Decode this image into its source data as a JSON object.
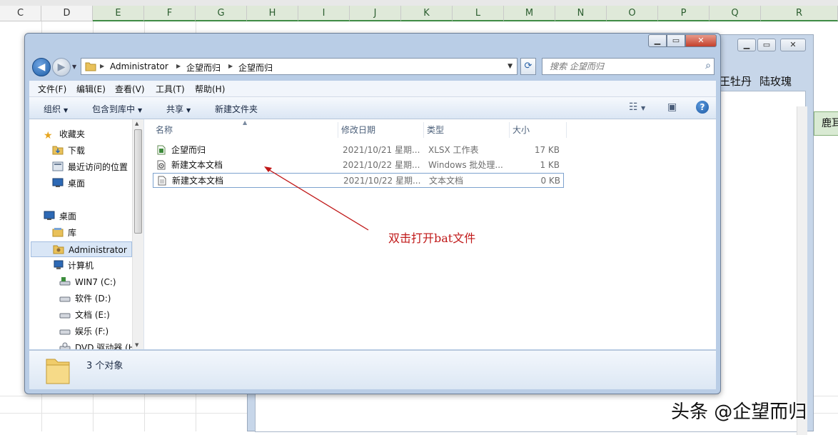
{
  "sheet": {
    "columns": [
      "C",
      "D",
      "E",
      "F",
      "G",
      "H",
      "I",
      "J",
      "K",
      "L",
      "M",
      "N",
      "O",
      "P",
      "Q",
      "R"
    ],
    "selected_columns": [
      "E",
      "F",
      "G",
      "H",
      "I",
      "J",
      "K",
      "L",
      "M",
      "N",
      "O",
      "P",
      "Q",
      "R"
    ]
  },
  "background_window": {
    "visible_text_1": "王牡丹",
    "visible_text_2": "陆玫瑰",
    "green_cell_text": "鹿耳"
  },
  "explorer": {
    "address": {
      "segments": [
        "Administrator",
        "企望而归",
        "企望而归"
      ]
    },
    "search": {
      "placeholder": "搜索 企望而归"
    },
    "menu": [
      "文件(F)",
      "编辑(E)",
      "查看(V)",
      "工具(T)",
      "帮助(H)"
    ],
    "toolbar": {
      "organize": "组织",
      "include_in_library": "包含到库中",
      "share": "共享",
      "new_folder": "新建文件夹",
      "help_icon": "?"
    },
    "nav_pane": {
      "favorites": "收藏夹",
      "downloads": "下载",
      "recent": "最近访问的位置",
      "desktop_fav": "桌面",
      "desktop": "桌面",
      "libraries": "库",
      "administrator": "Administrator",
      "computer": "计算机",
      "drive_c": "WIN7 (C:)",
      "drive_d": "软件 (D:)",
      "drive_e": "文档 (E:)",
      "drive_f": "娱乐 (F:)",
      "drive_dvd": "DVD 驱动器 (H"
    },
    "columns": {
      "name": "名称",
      "modified": "修改日期",
      "type": "类型",
      "size": "大小"
    },
    "files": [
      {
        "name": "企望而归",
        "modified": "2021/10/21 星期...",
        "type": "XLSX 工作表",
        "size": "17 KB",
        "icon": "xlsx-icon"
      },
      {
        "name": "新建文本文档",
        "modified": "2021/10/22 星期...",
        "type": "Windows 批处理...",
        "size": "1 KB",
        "icon": "bat-icon"
      },
      {
        "name": "新建文本文档",
        "modified": "2021/10/22 星期...",
        "type": "文本文档",
        "size": "0 KB",
        "icon": "txt-icon"
      }
    ],
    "status": {
      "count": "3 个对象"
    }
  },
  "annotation": {
    "text": "双击打开bat文件",
    "color": "#c01818"
  },
  "watermark": {
    "text": "头条 @企望而归"
  }
}
